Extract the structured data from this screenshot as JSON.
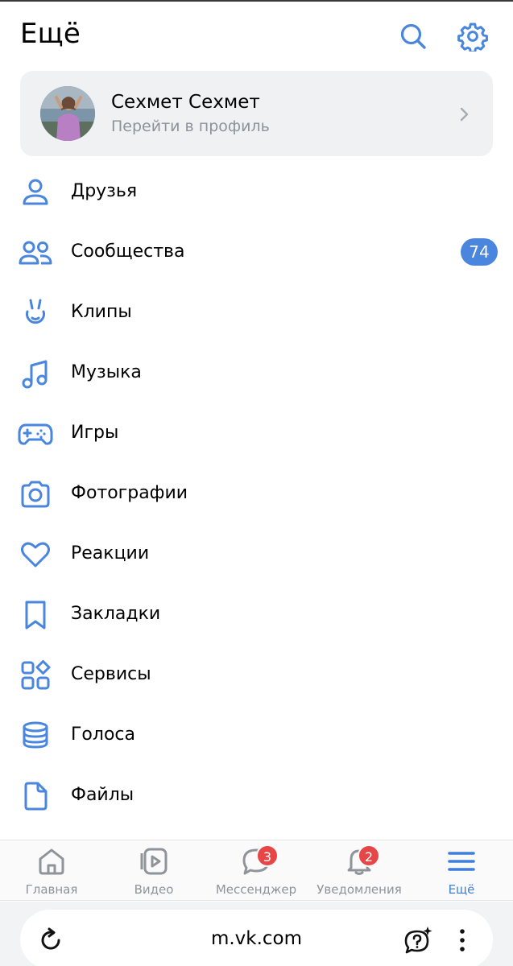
{
  "header": {
    "title": "Ещё"
  },
  "profile": {
    "name": "Сехмет Сехмет",
    "subtitle": "Перейти в профиль"
  },
  "menu": [
    {
      "label": "Друзья",
      "icon": "user-icon"
    },
    {
      "label": "Сообщества",
      "icon": "users-icon",
      "badge": "74"
    },
    {
      "label": "Клипы",
      "icon": "clips-icon"
    },
    {
      "label": "Музыка",
      "icon": "music-note-icon"
    },
    {
      "label": "Игры",
      "icon": "gamepad-icon"
    },
    {
      "label": "Фотографии",
      "icon": "camera-icon"
    },
    {
      "label": "Реакции",
      "icon": "heart-icon"
    },
    {
      "label": "Закладки",
      "icon": "bookmark-icon"
    },
    {
      "label": "Сервисы",
      "icon": "services-grid-icon"
    },
    {
      "label": "Голоса",
      "icon": "votes-coins-icon"
    },
    {
      "label": "Файлы",
      "icon": "file-icon"
    }
  ],
  "tabs": [
    {
      "label": "Главная",
      "icon": "home-icon"
    },
    {
      "label": "Видео",
      "icon": "video-play-icon"
    },
    {
      "label": "Мессенджер",
      "icon": "chat-bubble-icon",
      "badge": "3"
    },
    {
      "label": "Уведомления",
      "icon": "bell-icon",
      "badge": "2"
    },
    {
      "label": "Ещё",
      "icon": "hamburger-menu-icon",
      "active": true
    }
  ],
  "browser": {
    "url": "m.vk.com"
  },
  "colors": {
    "accent": "#4a86dd",
    "badge_red": "#e64646",
    "card_bg": "#f0f1f3",
    "muted_text": "#8d939a"
  }
}
